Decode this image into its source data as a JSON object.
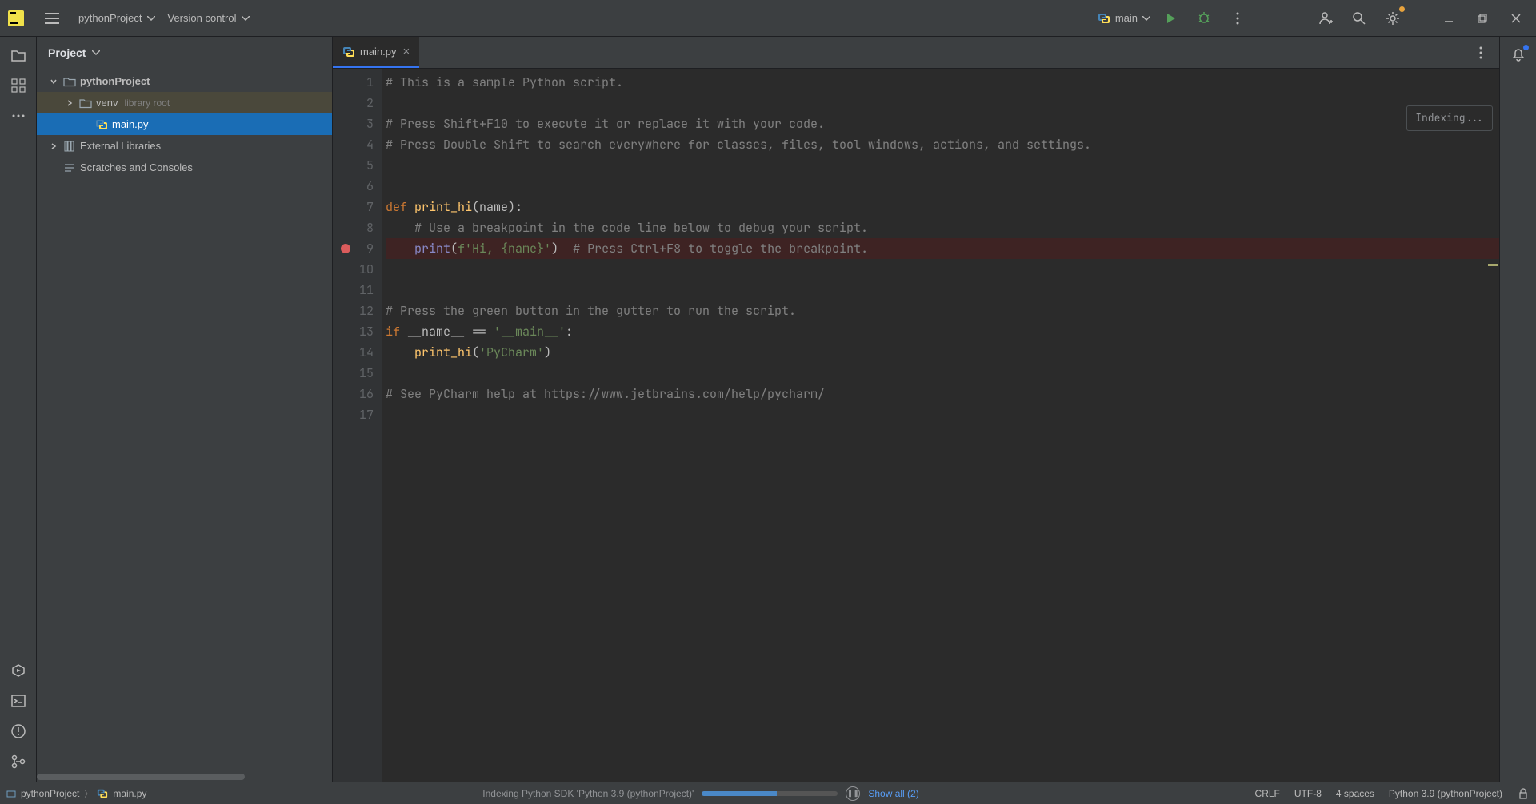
{
  "toolbar": {
    "project_name": "pythonProject",
    "version_control": "Version control",
    "run_config": "main"
  },
  "project_panel": {
    "title": "Project",
    "items": [
      {
        "label": "pythonProject",
        "icon": "folder",
        "expanded": true,
        "indent": 0
      },
      {
        "label": "venv",
        "hint": "library root",
        "icon": "folder",
        "expanded": false,
        "indent": 1,
        "highlight": "venv"
      },
      {
        "label": "main.py",
        "icon": "python",
        "indent": 2,
        "selected": true
      },
      {
        "label": "External Libraries",
        "icon": "libraries",
        "expanded": false,
        "indent": 0
      },
      {
        "label": "Scratches and Consoles",
        "icon": "scratches",
        "indent": 0
      }
    ]
  },
  "editor": {
    "tab_label": "main.py",
    "indexing_status": "Indexing...",
    "breakpoint_line": 9,
    "lines": [
      {
        "n": 1,
        "raw": "# This is a sample Python script."
      },
      {
        "n": 2,
        "raw": ""
      },
      {
        "n": 3,
        "raw": "# Press Shift+F10 to execute it or replace it with your code."
      },
      {
        "n": 4,
        "raw": "# Press Double Shift to search everywhere for classes, files, tool windows, actions, and settings."
      },
      {
        "n": 5,
        "raw": ""
      },
      {
        "n": 6,
        "raw": ""
      },
      {
        "n": 7,
        "raw": "def print_hi(name):"
      },
      {
        "n": 8,
        "raw": "    # Use a breakpoint in the code line below to debug your script."
      },
      {
        "n": 9,
        "raw": "    print(f'Hi, {name}')  # Press Ctrl+F8 to toggle the breakpoint."
      },
      {
        "n": 10,
        "raw": ""
      },
      {
        "n": 11,
        "raw": ""
      },
      {
        "n": 12,
        "raw": "# Press the green button in the gutter to run the script."
      },
      {
        "n": 13,
        "raw": "if __name__ == '__main__':"
      },
      {
        "n": 14,
        "raw": "    print_hi('PyCharm')"
      },
      {
        "n": 15,
        "raw": ""
      },
      {
        "n": 16,
        "raw": "# See PyCharm help at https://www.jetbrains.com/help/pycharm/"
      },
      {
        "n": 17,
        "raw": ""
      }
    ]
  },
  "status": {
    "breadcrumb_project": "pythonProject",
    "breadcrumb_file": "main.py",
    "indexing": "Indexing Python SDK 'Python 3.9 (pythonProject)'",
    "show_all": "Show all (2)",
    "line_sep": "CRLF",
    "encoding": "UTF-8",
    "indent": "4 spaces",
    "interpreter": "Python 3.9 (pythonProject)"
  },
  "colors": {
    "accent": "#3574f0",
    "breakpoint": "#db5c5c",
    "run_green": "#55a05a"
  }
}
